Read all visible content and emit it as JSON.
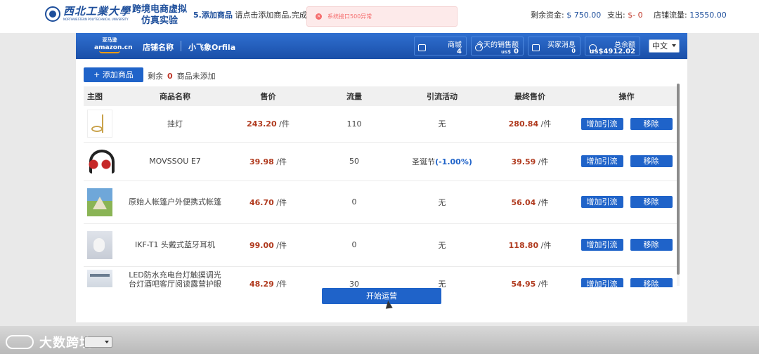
{
  "header": {
    "university_name": "西北工業大學",
    "university_name_en": "NORTHWESTERN POLYTECHNICAL UNIVERSITY",
    "sim_title": "跨境电商虚拟仿真实验",
    "step_label": "5.添加商品",
    "step_hint": "请点击添加商品,完成商品",
    "toast": "系统接口500异常",
    "stats": [
      {
        "label": "剩余资金:",
        "value": "$ 750.00"
      },
      {
        "label": "支出:",
        "value": "$- 0"
      },
      {
        "label": "店铺流量:",
        "value": "13550.00"
      }
    ]
  },
  "store": {
    "platform_cn": "亚马逊",
    "platform_en": "amazon.cn",
    "store_label": "店铺名称",
    "store_name": "小飞象Orfila",
    "boxes": [
      {
        "title": "商城",
        "value": "4",
        "currency": ""
      },
      {
        "title": "今天的销售额",
        "value": "0",
        "currency": "us$"
      },
      {
        "title": "买家消息",
        "value": "0",
        "currency": ""
      },
      {
        "title": "总余额",
        "value": "us$4912.02",
        "currency": ""
      }
    ],
    "language": "中文"
  },
  "toolbar": {
    "add_label": "+ 添加商品",
    "remain_prefix": "剩余",
    "remain_count": "0",
    "remain_suffix": "商品未添加"
  },
  "table": {
    "columns": [
      "主图",
      "商品名称",
      "售价",
      "流量",
      "引流活动",
      "最终售价",
      "操作"
    ],
    "unit": "/件",
    "rows": [
      {
        "thumb": "ceiling-lamp-image",
        "name": "挂灯",
        "price": "243.20",
        "traffic": "110",
        "campaign": "无",
        "campaign_rate": "",
        "final_price": "280.84"
      },
      {
        "thumb": "headphones-image",
        "name": "MOVSSOU E7",
        "price": "39.98",
        "traffic": "50",
        "campaign": "圣诞节",
        "campaign_rate": "(-1.00%)",
        "final_price": "39.59"
      },
      {
        "thumb": "tent-image",
        "name": "原始人帐篷户外便携式帐篷",
        "price": "46.70",
        "traffic": "0",
        "campaign": "无",
        "campaign_rate": "",
        "final_price": "56.04"
      },
      {
        "thumb": "earphone-image",
        "name": "IKF-T1 头戴式蓝牙耳机",
        "price": "99.00",
        "traffic": "0",
        "campaign": "无",
        "campaign_rate": "",
        "final_price": "118.80"
      },
      {
        "thumb": "desk-lamp-image",
        "name": "LED防水充电台灯触摸调光台灯酒吧客厅阅读露营护眼灯",
        "price": "48.29",
        "traffic": "30",
        "campaign": "无",
        "campaign_rate": "",
        "final_price": "54.95"
      }
    ],
    "actions": {
      "boost": "增加引流",
      "remove": "移除"
    }
  },
  "start_label": "开始运营",
  "watermark": "大数跨境",
  "colors": {
    "primary": "#1f63c9",
    "price": "#b03a1e",
    "error": "#f56c6c"
  }
}
